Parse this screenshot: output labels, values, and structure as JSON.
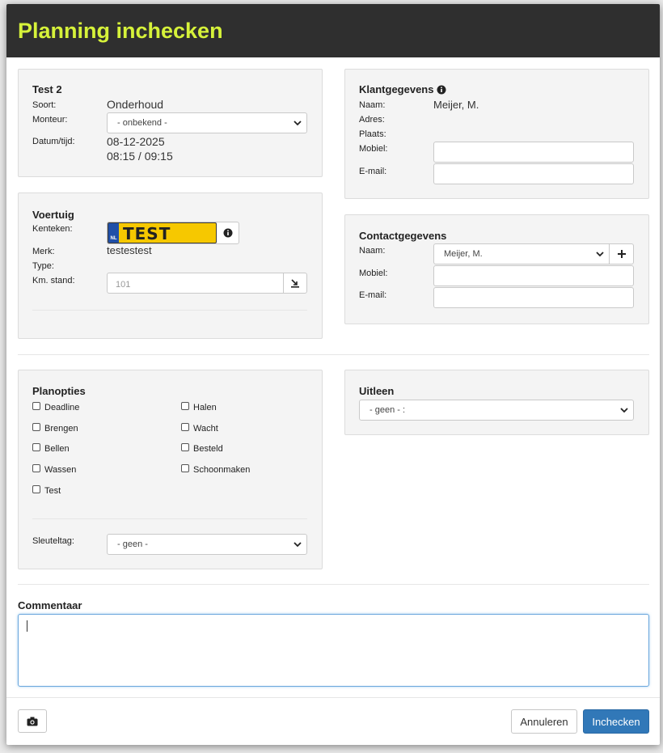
{
  "header": {
    "title": "Planning inchecken"
  },
  "appointment": {
    "title": "Test 2",
    "soort_label": "Soort:",
    "soort_value": "Onderhoud",
    "monteur_label": "Monteur:",
    "monteur_selected": "- onbekend -",
    "datetime_label": "Datum/tijd:",
    "date": "08-12-2025",
    "time": "08:15 / 09:15"
  },
  "vehicle": {
    "title": "Voertuig",
    "kenteken_label": "Kenteken:",
    "plate": "TEST",
    "plate_country": "NL",
    "merk_label": "Merk:",
    "merk_value": "testestest",
    "type_label": "Type:",
    "km_label": "Km. stand:",
    "km_placeholder": "101"
  },
  "customer": {
    "title": "Klantgegevens",
    "naam_label": "Naam:",
    "naam_value": "Meijer, M.",
    "adres_label": "Adres:",
    "plaats_label": "Plaats:",
    "mobiel_label": "Mobiel:",
    "email_label": "E-mail:"
  },
  "contact": {
    "title": "Contactgegevens",
    "naam_label": "Naam:",
    "naam_selected": "Meijer, M.",
    "mobiel_label": "Mobiel:",
    "email_label": "E-mail:"
  },
  "plan_options": {
    "title": "Planopties",
    "options": [
      "Deadline",
      "Halen",
      "Brengen",
      "Wacht",
      "Bellen",
      "Besteld",
      "Wassen",
      "Schoonmaken",
      "Test"
    ],
    "sleuteltag_label": "Sleuteltag:",
    "sleuteltag_selected": "- geen -"
  },
  "loan": {
    "title": "Uitleen",
    "selected": "- geen - :"
  },
  "comment": {
    "label": "Commentaar"
  },
  "footer": {
    "camera_icon": "camera-icon",
    "cancel_label": "Annuleren",
    "submit_label": "Inchecken"
  },
  "colors": {
    "header_bg": "#2f2f2f",
    "title_color": "#d6f23a",
    "primary": "#3178b8",
    "plate_yellow": "#f6c800",
    "plate_blue": "#1f4fa8"
  }
}
